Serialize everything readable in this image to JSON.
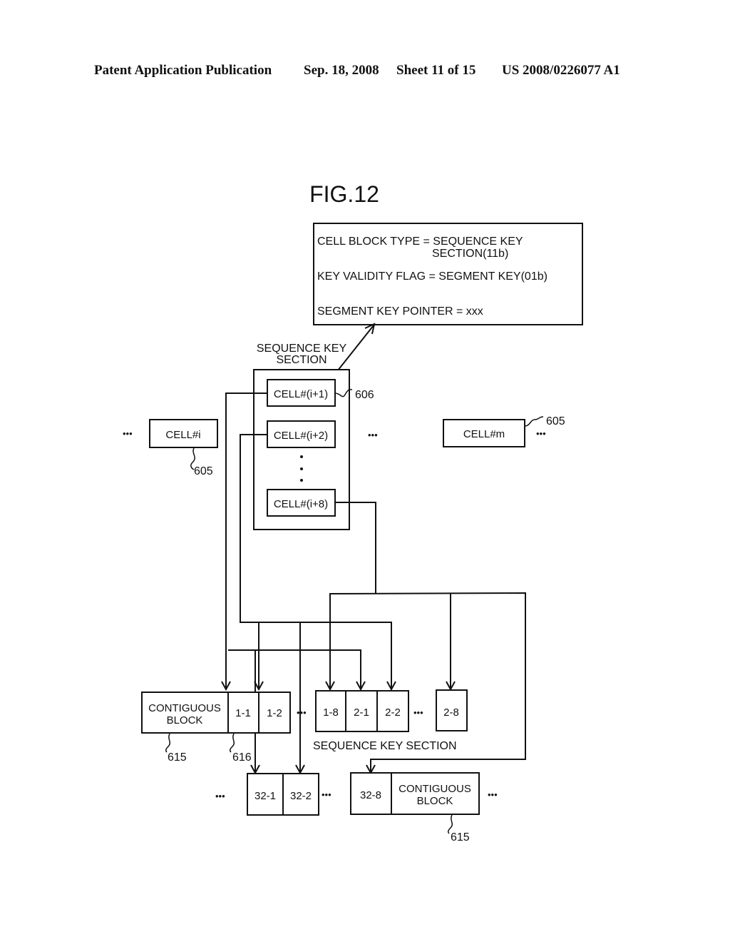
{
  "header": {
    "publication": "Patent Application Publication",
    "date": "Sep. 18, 2008",
    "sheet": "Sheet 11 of 15",
    "number": "US 2008/0226077 A1"
  },
  "figure": {
    "title": "FIG.12",
    "info_box": {
      "line1": "CELL BLOCK TYPE = SEQUENCE KEY",
      "line1b": "SECTION(11b)",
      "line2": "KEY VALIDITY FLAG = SEGMENT KEY(01b)",
      "line3": "SEGMENT KEY POINTER = xxx"
    },
    "sequence_key_section_label": [
      "SEQUENCE KEY",
      "SECTION"
    ],
    "cells": {
      "cell_i": "CELL#i",
      "cell_i1": "CELL#(i+1)",
      "cell_i2": "CELL#(i+2)",
      "cell_i8": "CELL#(i+8)",
      "cell_m": "CELL#m"
    },
    "ellipsis": "•••",
    "ref_605": "605",
    "ref_606": "606",
    "ref_615": "615",
    "ref_616": "616",
    "row1": {
      "contiguous_block": [
        "CONTIGUOUS",
        "BLOCK"
      ],
      "segments": [
        "1-1",
        "1-2",
        "1-8",
        "2-1",
        "2-2",
        "2-8"
      ],
      "caption": "SEQUENCE KEY SECTION"
    },
    "row2": {
      "segments": [
        "32-1",
        "32-2",
        "32-8"
      ],
      "contiguous_block": [
        "CONTIGUOUS",
        "BLOCK"
      ]
    }
  }
}
